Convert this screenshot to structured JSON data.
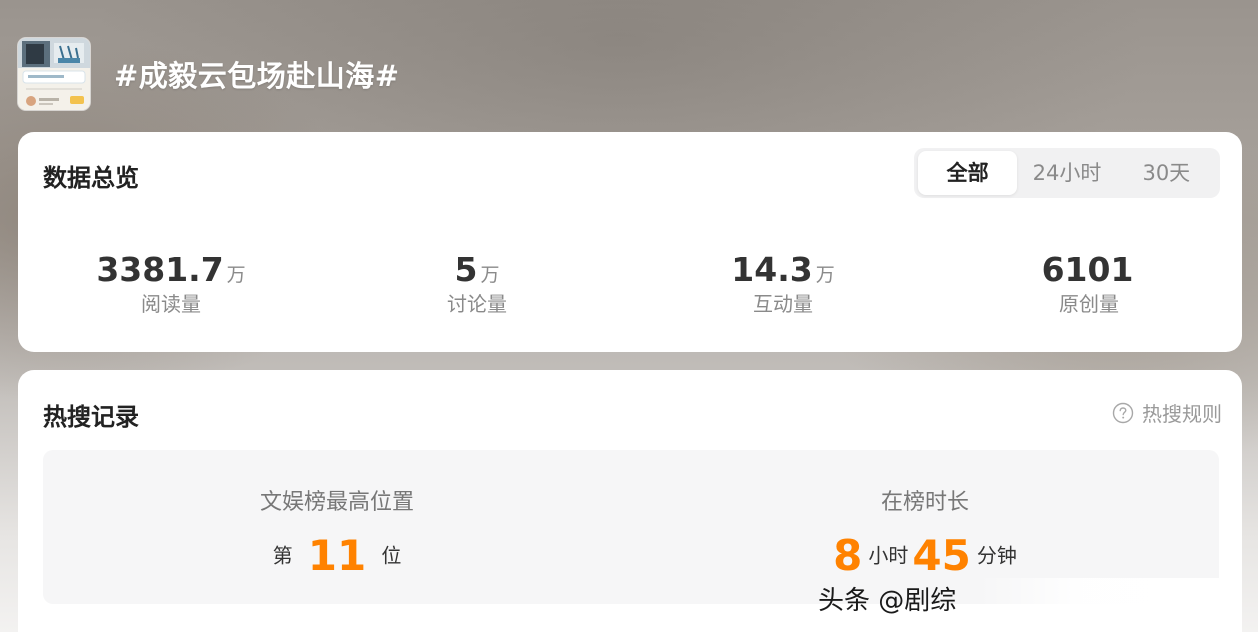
{
  "header": {
    "title": "#成毅云包场赴山海#",
    "thumbnail_icon": "topic-cover-image"
  },
  "overview": {
    "title": "数据总览",
    "tabs": [
      {
        "label": "全部",
        "active": true
      },
      {
        "label": "24小时",
        "active": false
      },
      {
        "label": "30天",
        "active": false
      }
    ],
    "stats": [
      {
        "value": "3381.7",
        "unit": "万",
        "label": "阅读量"
      },
      {
        "value": "5",
        "unit": "万",
        "label": "讨论量"
      },
      {
        "value": "14.3",
        "unit": "万",
        "label": "互动量"
      },
      {
        "value": "6101",
        "unit": "",
        "label": "原创量"
      }
    ]
  },
  "hot_search": {
    "title": "热搜记录",
    "rules_label": "热搜规则",
    "rules_icon": "question-circle-icon",
    "peak": {
      "label": "文娱榜最高位置",
      "prefix": "第",
      "value": "11",
      "suffix": "位"
    },
    "duration": {
      "label": "在榜时长",
      "hours": "8",
      "hours_unit": "小时",
      "minutes": "45",
      "minutes_unit": "分钟"
    }
  },
  "watermark": {
    "text": "头条 @剧综"
  },
  "colors": {
    "accent": "#ff8200",
    "card_bg": "#ffffff",
    "panel_bg": "#f6f6f7",
    "tab_bg": "#f1f1f2"
  }
}
